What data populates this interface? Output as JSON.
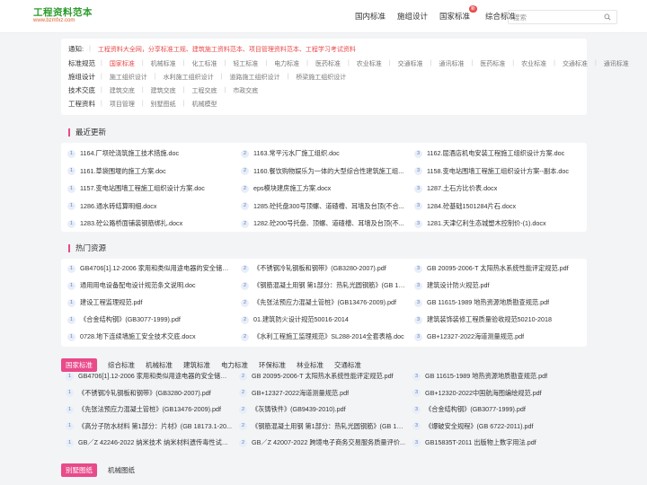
{
  "header": {
    "logo_title": "工程资料范本",
    "logo_sub": "www.bzmfxz.com",
    "nav": [
      "国内标准",
      "施组设计",
      "国家标准",
      "综合标准"
    ],
    "nav_badge": "新",
    "search_placeholder": "搜索"
  },
  "categories": {
    "notice_label": "通知:",
    "notice_text": "工程资料大全网，分享标准工规、建筑施工资料范本、项目管理资料范本、工程学习考试资料",
    "rows": [
      {
        "label": "标准规范",
        "items": [
          "国家标准",
          "机械标准",
          "化工标准",
          "轻工标准",
          "电力标准",
          "医药标准",
          "农业标准",
          "交通标准",
          "通讯标准",
          "医药标准",
          "农业标准",
          "交通标准",
          "通讯标准"
        ]
      },
      {
        "label": "施组设计",
        "items": [
          "施工组织设计",
          "水利施工组织设计",
          "道路施工组织设计",
          "桥梁施工组织设计"
        ]
      },
      {
        "label": "技术交底",
        "items": [
          "建筑交底",
          "建筑交底",
          "工程交底",
          "市政交底"
        ]
      },
      {
        "label": "工程资料",
        "items": [
          "项目管理",
          "别墅图纸",
          "机械模型"
        ]
      }
    ]
  },
  "recent": {
    "title": "最近更新",
    "items": [
      "1164.厂坝砼浇筑施工技术措施.doc",
      "1163.常平污水厂施工组织.doc",
      "1162.屈酒店机电安装工程施工组织设计方案.doc",
      "1161.草袋围堰的施工方案.doc",
      "1160.餐饮购物娱乐为一体的大型综合性建筑施工组...",
      "1158.变电站围墙工程施工组织设计方案--副本.doc",
      "1157.变电站围墙工程施工组织设计方案.doc",
      "eps模块建房施工方案.docx",
      "1287.土石方比价表.docx",
      "1286.通水砖结算明细.docx",
      "1285.砼托盘300号顶螺、道碴槽、耳墙及台顶(不合...",
      "1284.砼基础1501284片石.docx",
      "1283.砼公路桥面铺装钢筋绑扎.docx",
      "1282.砼200号托盘、顶螺、道碴槽、耳墙及台顶(不...",
      "1281.天津亿利生态城塑木控制价-(1).docx"
    ]
  },
  "hot": {
    "title": "热门资源",
    "items": [
      "GB4706[1].12-2006 家用和类似用途电器的安全储水...",
      "《不锈钢冷轧钢板和钢带》(GB3280-2007).pdf",
      "GB 20095-2006-T 太阳热水系统性能评定规范.pdf",
      "通用用电设备配电设计规范条文说明.doc",
      "《钢筋混凝土用钢 第1部分：热轧光圆钢筋》(GB 14...",
      "建筑设计防火规范.pdf",
      "建设工程监理规范.pdf",
      "《先张法预应力混凝土管桩》(GB13476-2009).pdf",
      "GB 11615-1989 地热资源地质勘查规范.pdf",
      "《合金结构钢》(GB3077-1999).pdf",
      "01.建筑防火设计规范50016-2014",
      "建筑装饰装修工程质量验收规范50210-2018",
      "0728.地下连续墙施工安全技术交底.docx",
      "《水利工程施工监理规范》SL288-2014全套表格.doc",
      "GB+12327-2022海道测量规范.pdf"
    ]
  },
  "standards": {
    "tabs": [
      "国家标准",
      "综合标准",
      "机械标准",
      "建筑标准",
      "电力标准",
      "环保标准",
      "林业标准",
      "交通标准"
    ],
    "items": [
      "GB4706[1].12-2006 家用和类似用途电器的安全储水...",
      "GB 20095-2006-T 太阳热水系统性能评定规范.pdf",
      "GB 11615-1989 地热资源地质勘查规范.pdf",
      "《不锈钢冷轧钢板和钢带》(GB3280-2007).pdf",
      "GB+12327-2022海道测量规范.pdf",
      "GB+12320-2022中国航海图编绘规范.pdf",
      "《先张法预应力混凝土管桩》(GB13476-2009).pdf",
      "《灰铸铁件》(GB9439-2010).pdf",
      "《合金结构钢》(GB3077-1999).pdf",
      "《高分子防水材料 第1部分：片材》(GB 18173.1-20...",
      "《钢筋混凝土用钢 第1部分：热轧光圆钢筋》(GB 14...",
      "《爆破安全规程》(GB 6722-2011).pdf",
      "GB／Z 42246-2022 纳米技术 纳米材料遗传毒性试验...",
      "GB／Z 42007-2022 跨境电子商务交易服务质量评价...",
      "GB15835T-2011 出版物上数字用法.pdf"
    ]
  },
  "drawings": {
    "tabs": [
      "别墅图纸",
      "机械图纸"
    ]
  }
}
